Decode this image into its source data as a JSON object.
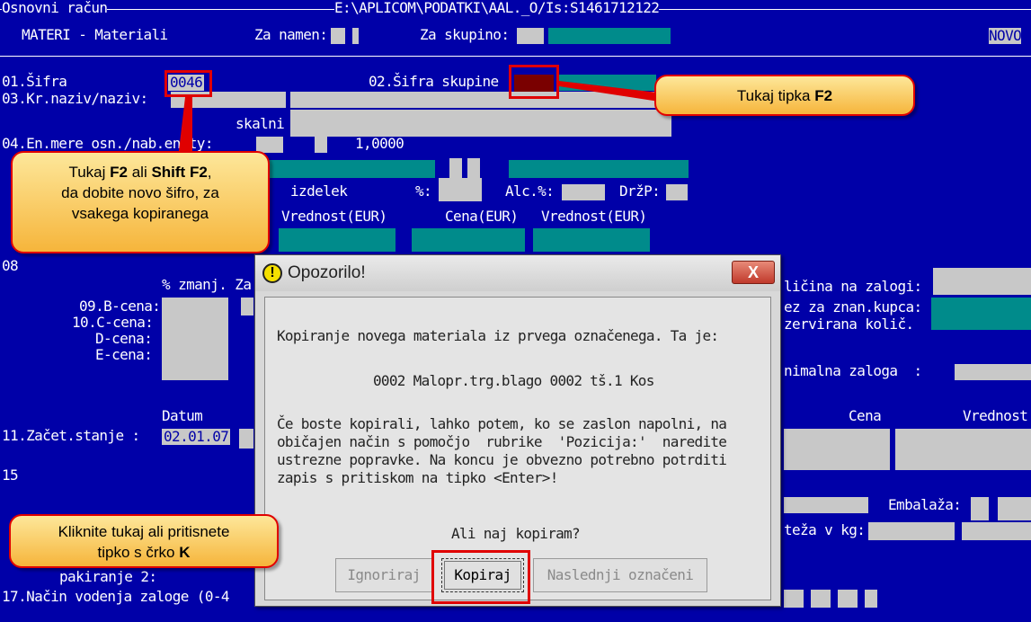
{
  "window": {
    "title_left": "Osnovni račun",
    "title_path": "E:\\APLICOM\\PODATKI\\AAL._O/Is:S1461712122",
    "module": "MATERI - Materiali",
    "za_namen_label": "Za namen:",
    "za_skupino_label": "Za skupino:",
    "mode_badge": "NOVO"
  },
  "form": {
    "sifra_label": "01.Šifra",
    "sifra_value": "0046",
    "sifra_skupine_label": "02.Šifra skupine",
    "kr_naziv_label": "03.Kr.naziv/naziv:",
    "skalni_niz_label": "skalni niz:",
    "en_mere_label": "04.En.mere osn./nab.enoty:",
    "en_mere_value": "1,0000",
    "izdelek_label": "izdelek",
    "pct_label": "%:",
    "alc_label": "Alc.%:",
    "drzp_label": "DržP:",
    "vrednost_eur_1": "Vrednost(EUR)",
    "cena_eur": "Cena(EUR)",
    "vrednost_eur_2": "Vrednost(EUR)",
    "row08_prefix": "08",
    "pct_zmanj_label": "% zmanj. Za",
    "b_cena_label": "09.B-cena:",
    "c_cena_label": "10.C-cena:",
    "d_cena_label": "D-cena:",
    "e_cena_label": "E-cena:",
    "kolicina_zalogi_label": "ličina na zalogi:",
    "rez_znan_kupca_label": "ez za znan.kupca:",
    "rezervirana_label": "zervirana količ.",
    "minimalna_zaloga_label": "nimalna zaloga  :",
    "datum_label": "Datum",
    "zacet_stanje_label": "11.Začet.stanje :",
    "zacet_stanje_date": "02.01.07",
    "cena_label": "Cena",
    "vrednost_label": "Vrednost",
    "embalaza_label": "Embalaža:",
    "teza_label": "teža v kg:",
    "row15_prefix": "15",
    "pakiranje_label": "pakiranje 2:",
    "nacin_vodenja_label": "17.Način vodenja zaloge (0-4"
  },
  "dialog": {
    "title": "Opozorilo!",
    "close_label": "X",
    "line1": "Kopiranje novega materiala iz prvega označenega. Ta je:",
    "item": "0002 Malopr.trg.blago 0002 tš.1 Kos",
    "para_lines": [
      "Če boste kopirali, lahko potem, ko se zaslon napolni, na",
      "običajen način s pomočjo  rubrike  'Pozicija:'  naredite",
      "ustrezne popravke. Na koncu je obvezno potrebno potrditi",
      "zapis s pritiskom na tipko <Enter>!"
    ],
    "question": "Ali naj kopiram?",
    "buttons": {
      "ignore": "Ignoriraj",
      "copy": "Kopiraj",
      "next": "Naslednji označeni"
    }
  },
  "callouts": {
    "f2_group_text": "Tukaj tipka ",
    "f2_group_key": "F2",
    "f2_code_1": "Tukaj ",
    "f2_code_key1": "F2",
    "f2_code_2": " ali ",
    "f2_code_key2": "Shift F2",
    "f2_code_3": ",",
    "f2_code_line2": "da dobite novo šifro, za",
    "f2_code_line3": "vsakega kopiranega",
    "click_line1": "Kliknite tukaj ali pritisnete",
    "click_line2": "tipko s črko ",
    "click_key": "K"
  },
  "colors": {
    "dos_background": "#0000a8",
    "field_gray": "#c8c8c8",
    "teal": "#008b8b",
    "annotation_red": "#e00000",
    "callout_yellow": "#f6b53b"
  }
}
